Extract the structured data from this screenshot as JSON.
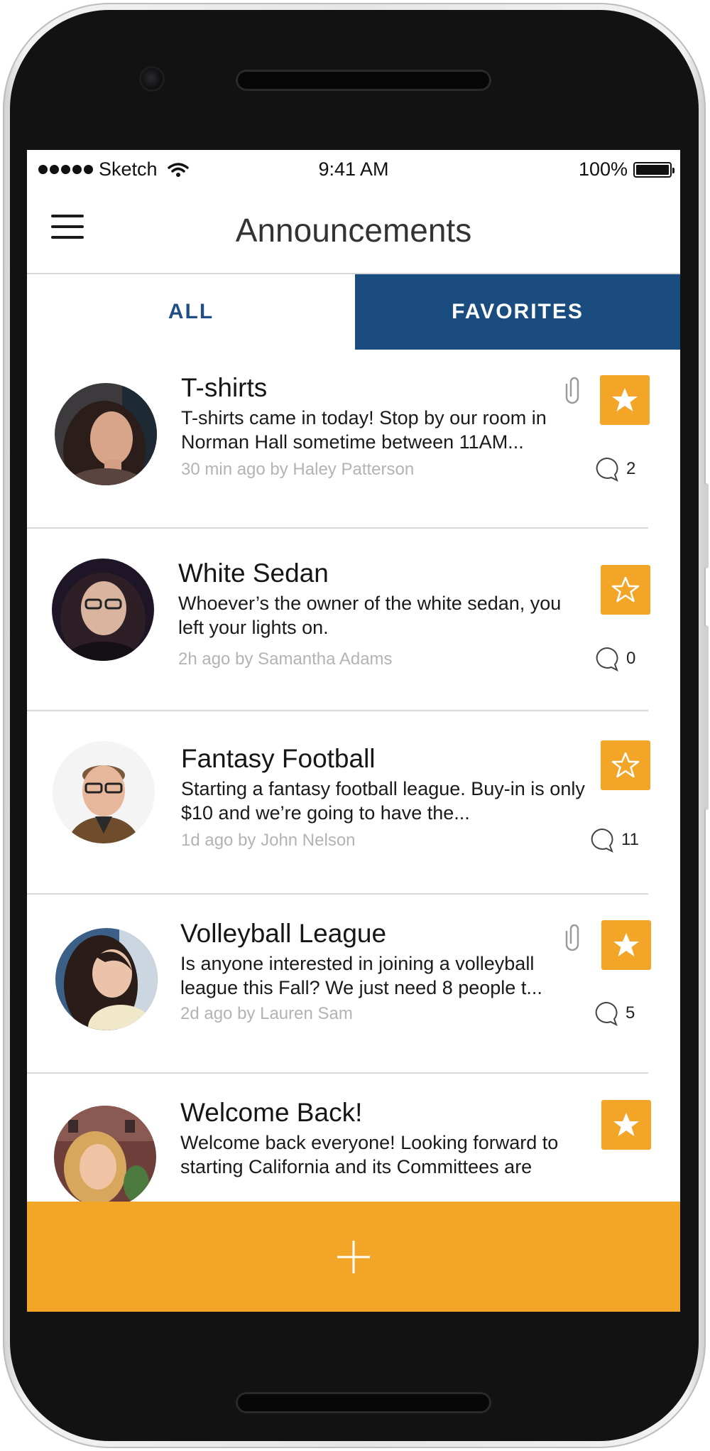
{
  "status_bar": {
    "carrier": "Sketch",
    "time": "9:41 AM",
    "battery": "100%"
  },
  "header": {
    "title": "Announcements"
  },
  "tabs": [
    {
      "label": "ALL",
      "active": false
    },
    {
      "label": "FAVORITES",
      "active": true
    }
  ],
  "announcements": [
    {
      "title": "T-shirts",
      "body": "T-shirts came in today! Stop by our room in Norman Hall sometime between 11AM...",
      "meta": "30 min ago by Haley Patterson",
      "comments": "2",
      "attachment": true,
      "favorited": true
    },
    {
      "title": "White Sedan",
      "body": "Whoever’s the owner of the white sedan, you left your lights on.",
      "meta": "2h ago by Samantha Adams",
      "comments": "0",
      "attachment": false,
      "favorited": false
    },
    {
      "title": "Fantasy Football",
      "body": "Starting a fantasy football league.  Buy-in is only $10 and we’re going to have the...",
      "meta": "1d ago by John Nelson",
      "comments": "11",
      "attachment": false,
      "favorited": false
    },
    {
      "title": "Volleyball League",
      "body": "Is anyone interested in joining a volleyball league this Fall?  We just need 8 people t...",
      "meta": "2d  ago by Lauren Sam",
      "comments": "5",
      "attachment": true,
      "favorited": true
    },
    {
      "title": "Welcome Back!",
      "body": "Welcome back everyone! Looking forward to starting California and its Committees are",
      "meta": "",
      "comments": "",
      "attachment": false,
      "favorited": true
    }
  ],
  "colors": {
    "accent": "#f2a526",
    "navy": "#1b4c7f",
    "tab_text": "#1f4f84",
    "meta": "#b3b3b3"
  },
  "icons": {
    "menu": "hamburger-icon",
    "attachment": "paperclip-icon",
    "favorite": "star-icon",
    "comments": "speech-bubble-icon",
    "add": "plus-icon"
  }
}
